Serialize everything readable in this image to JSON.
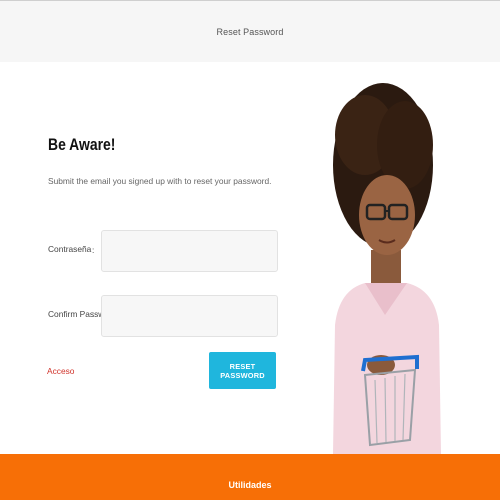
{
  "header": {
    "title": "Reset Password"
  },
  "form": {
    "heading": "Be Aware!",
    "subtitle": "Submit the email you signed up with to reset your password.",
    "fields": [
      {
        "label": "Contraseña",
        "separator": ":",
        "value": "",
        "placeholder": ""
      },
      {
        "label": "Confirm Password",
        "separator": ":",
        "value": "",
        "placeholder": ""
      }
    ],
    "login_link": "Acceso",
    "submit_label": "RESET PASSWORD"
  },
  "image": {
    "icon": "woman-with-shopping-cart-photo"
  },
  "footer": {
    "label": "Utilidades"
  },
  "colors": {
    "accent": "#1fb6dd",
    "footer": "#f76f06",
    "link": "#d0332b"
  }
}
